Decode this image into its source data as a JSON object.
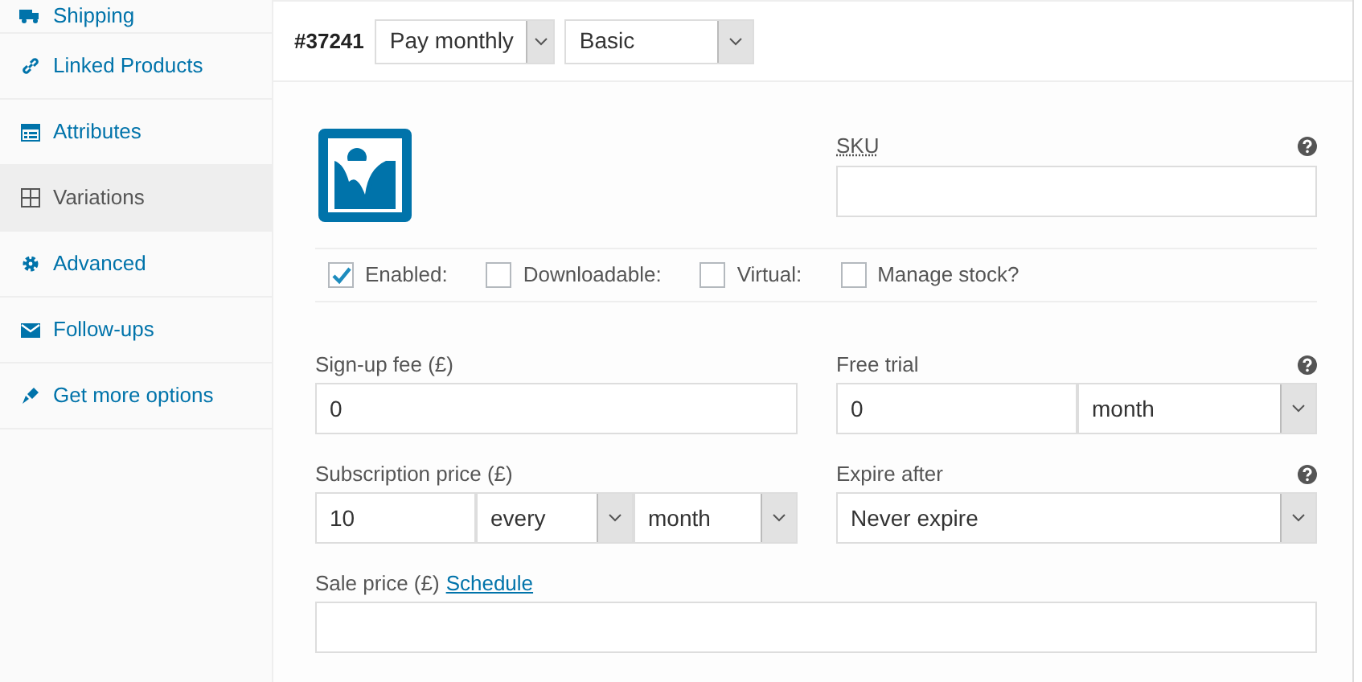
{
  "sidebar": {
    "items": [
      {
        "label": "Shipping",
        "selected": false
      },
      {
        "label": "Linked Products",
        "selected": false
      },
      {
        "label": "Attributes",
        "selected": false
      },
      {
        "label": "Variations",
        "selected": true
      },
      {
        "label": "Advanced",
        "selected": false
      },
      {
        "label": "Follow-ups",
        "selected": false
      },
      {
        "label": "Get more options",
        "selected": false
      }
    ]
  },
  "variation": {
    "id": "#37241",
    "selects": [
      "Pay monthly",
      "Basic"
    ]
  },
  "sku": {
    "label": "SKU"
  },
  "options": [
    {
      "label": "Enabled:",
      "checked": true
    },
    {
      "label": "Downloadable:",
      "checked": false
    },
    {
      "label": "Virtual:",
      "checked": false
    },
    {
      "label": "Manage stock?",
      "checked": false
    }
  ],
  "signup_fee": {
    "label": "Sign-up fee (£)",
    "value": "0"
  },
  "free_trial": {
    "label": "Free trial",
    "value": "0",
    "period": "month"
  },
  "subscription_price": {
    "label": "Subscription price (£)",
    "value": "10",
    "interval": "every",
    "period": "month"
  },
  "expire_after": {
    "label": "Expire after",
    "value": "Never expire"
  },
  "sale_price": {
    "label": "Sale price (£)",
    "link": "Schedule"
  }
}
